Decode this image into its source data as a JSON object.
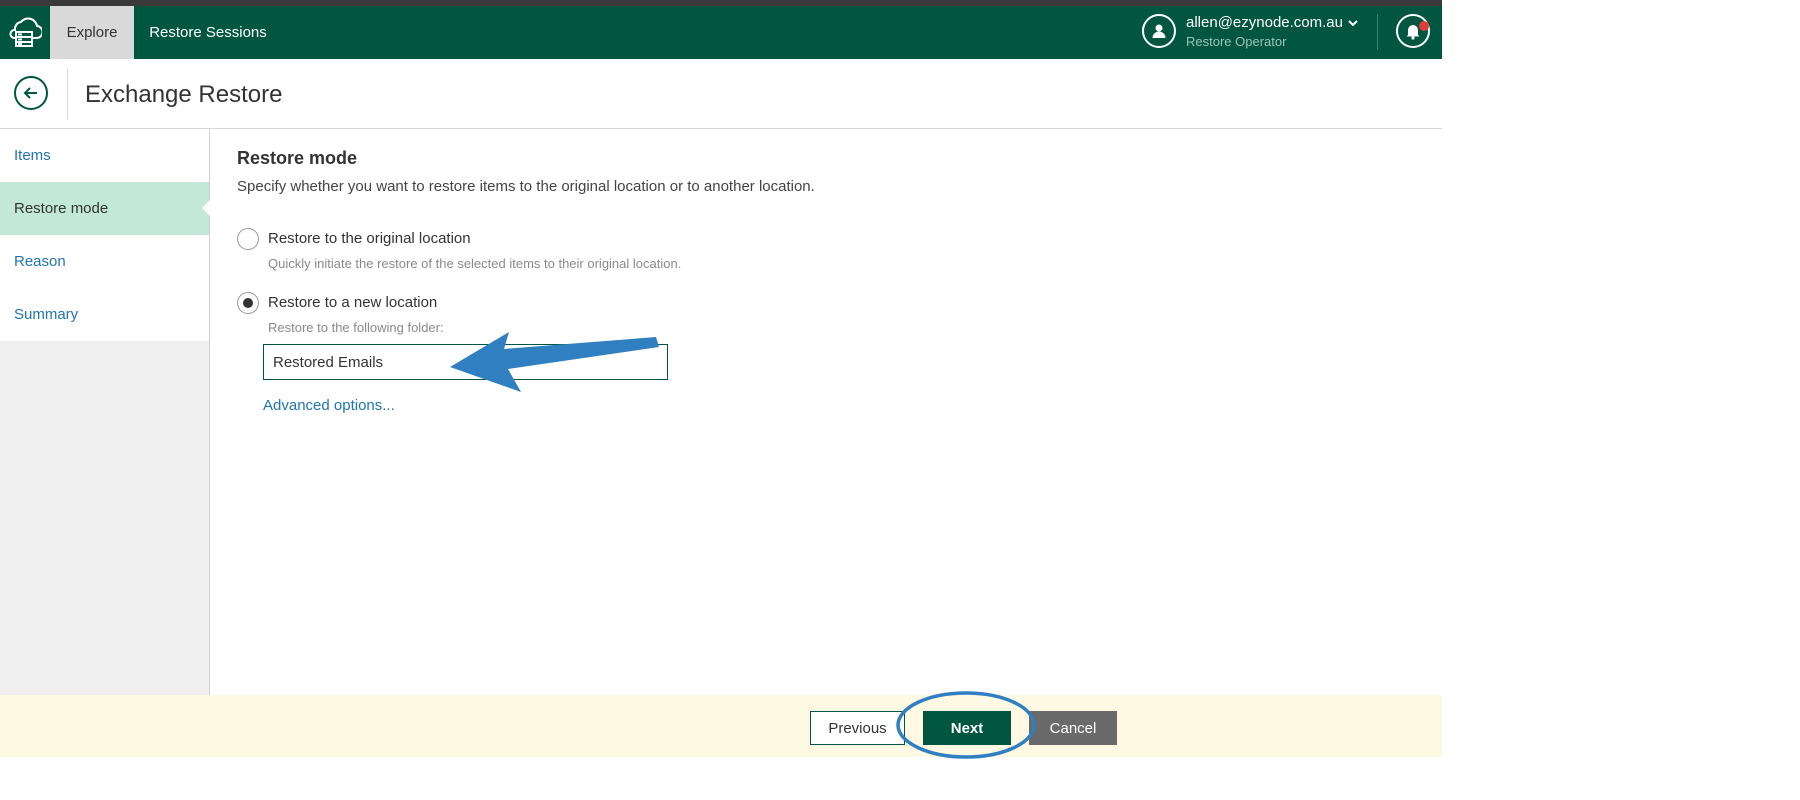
{
  "header": {
    "tabs": [
      {
        "label": "Explore",
        "active": true
      },
      {
        "label": "Restore Sessions",
        "active": false
      }
    ],
    "user": {
      "email": "allen@ezynode.com.au",
      "role": "Restore Operator"
    },
    "icons": [
      "cloud-server-logo-icon",
      "user-icon",
      "chevron-down-icon",
      "bell-icon"
    ]
  },
  "page": {
    "title": "Exchange Restore"
  },
  "sidebar": {
    "items": [
      {
        "label": "Items",
        "active": false
      },
      {
        "label": "Restore mode",
        "active": true
      },
      {
        "label": "Reason",
        "active": false
      },
      {
        "label": "Summary",
        "active": false
      }
    ]
  },
  "main": {
    "title": "Restore mode",
    "description": "Specify whether you want to restore items to the original location or to another location.",
    "options": [
      {
        "label": "Restore to the original location",
        "hint": "Quickly initiate the restore of the selected items to their original location.",
        "selected": false
      },
      {
        "label": "Restore to a new location",
        "hint": "Restore to the following folder:",
        "selected": true
      }
    ],
    "folder_value": "Restored Emails",
    "advanced_label": "Advanced options..."
  },
  "footer": {
    "previous": "Previous",
    "next": "Next",
    "cancel": "Cancel"
  },
  "colors": {
    "brand": "#00563f",
    "link": "#1f74b1",
    "annotation": "#2f7fc1",
    "footer_bg": "#fdf9e3",
    "active_nav": "#c3e8d7"
  }
}
